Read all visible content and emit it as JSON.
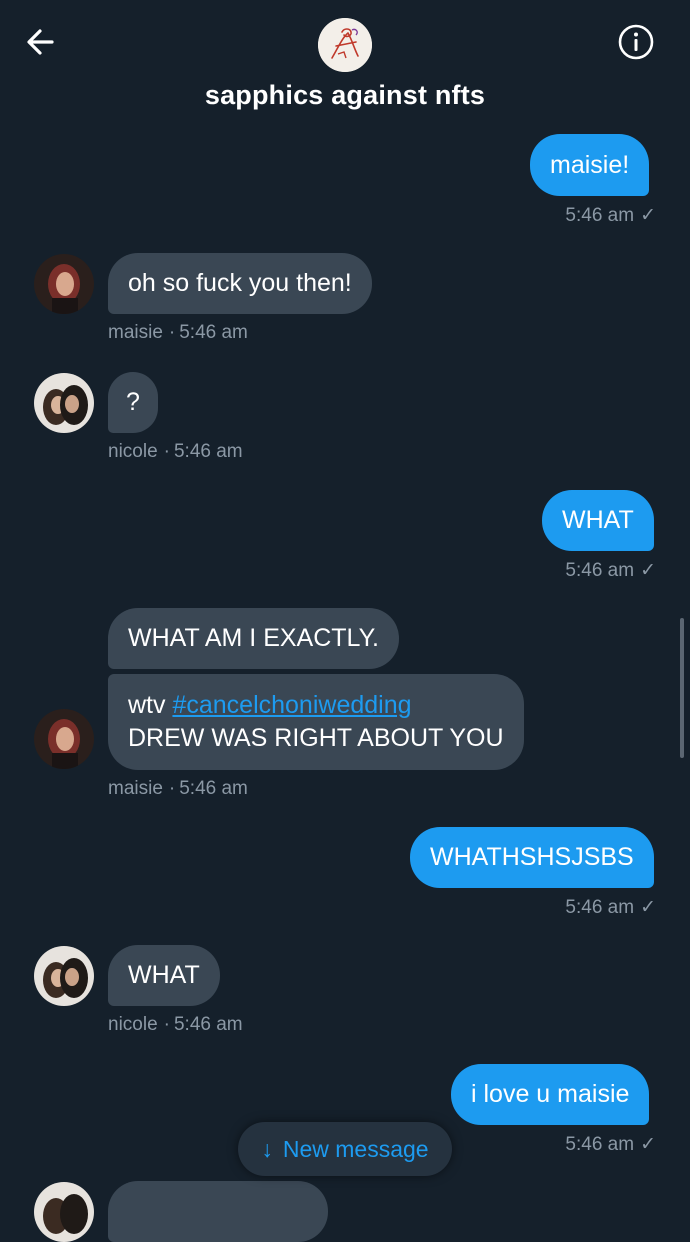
{
  "header": {
    "title": "sapphics against nfts",
    "back_icon": "arrow-left-icon",
    "info_icon": "info-icon"
  },
  "messages": [
    {
      "side": "out",
      "text": "maisie!",
      "time": "5:46 am",
      "status": "✓"
    },
    {
      "side": "in",
      "text": "oh so fuck you then!",
      "sender": "maisie",
      "sep": "·",
      "time": "5:46 am"
    },
    {
      "side": "in",
      "text": "?",
      "sender": "nicole",
      "sep": "·",
      "time": "5:46 am"
    },
    {
      "side": "out",
      "text": "WHAT",
      "time": "5:46 am",
      "status": "✓"
    },
    {
      "side": "in",
      "text1": "WHAT AM I EXACTLY.",
      "text2_prefix": "wtv ",
      "hashtag": "#cancelchoniwedding",
      "text2_line2": "DREW WAS RIGHT ABOUT YOU",
      "sender": "maisie",
      "sep": "·",
      "time": "5:46 am"
    },
    {
      "side": "out",
      "text": "WHATHSHSJSBS",
      "time": "5:46 am",
      "status": "✓"
    },
    {
      "side": "in",
      "text": "WHAT",
      "sender": "nicole",
      "sep": "·",
      "time": "5:46 am"
    },
    {
      "side": "out",
      "text": "i love u maisie",
      "time": "5:46 am",
      "status": "✓"
    }
  ],
  "new_message_button": {
    "arrow": "↓",
    "label": "New message"
  },
  "colors": {
    "background": "#15202b",
    "outgoing": "#1d9bf0",
    "incoming": "#3a4754",
    "meta": "#8b98a5"
  }
}
